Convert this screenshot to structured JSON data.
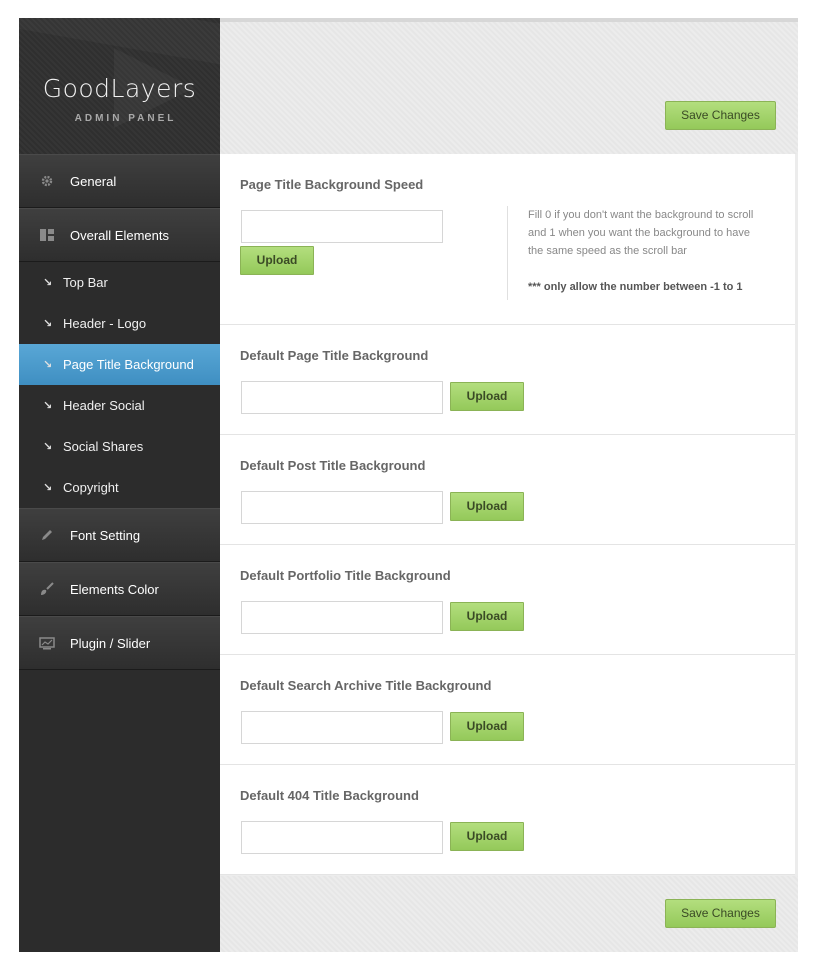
{
  "brand": {
    "title": "GoodLayers",
    "subtitle": "ADMIN PANEL"
  },
  "sidebar": {
    "items": [
      {
        "label": "General",
        "icon": "gear-icon"
      },
      {
        "label": "Overall Elements",
        "icon": "layout-icon"
      }
    ],
    "sub_items": [
      {
        "label": "Top Bar"
      },
      {
        "label": "Header - Logo"
      },
      {
        "label": "Page Title Background",
        "active": true
      },
      {
        "label": "Header Social"
      },
      {
        "label": "Social Shares"
      },
      {
        "label": "Copyright"
      }
    ],
    "items_after": [
      {
        "label": "Font Setting",
        "icon": "pencil-icon"
      },
      {
        "label": "Elements Color",
        "icon": "brush-icon"
      },
      {
        "label": "Plugin / Slider",
        "icon": "slider-icon"
      }
    ]
  },
  "toolbar": {
    "save_label": "Save Changes"
  },
  "sections": [
    {
      "title": "Page Title Background Speed",
      "input_value": "",
      "upload_label": "Upload",
      "description": "Fill 0 if you don't want the background to scroll and 1 when you want the background to have the same speed as the scroll bar",
      "note": "*** only allow the number between -1 to 1"
    },
    {
      "title": "Default Page Title Background",
      "input_value": "",
      "upload_label": "Upload"
    },
    {
      "title": "Default Post Title Background",
      "input_value": "",
      "upload_label": "Upload"
    },
    {
      "title": "Default Portfolio Title Background",
      "input_value": "",
      "upload_label": "Upload"
    },
    {
      "title": "Default Search Archive Title Background",
      "input_value": "",
      "upload_label": "Upload"
    },
    {
      "title": "Default 404 Title Background",
      "input_value": "",
      "upload_label": "Upload"
    }
  ],
  "colors": {
    "accent_active": "#4a9acb",
    "button_green": "#a6d470",
    "sidebar_bg": "#2c2c2c"
  }
}
